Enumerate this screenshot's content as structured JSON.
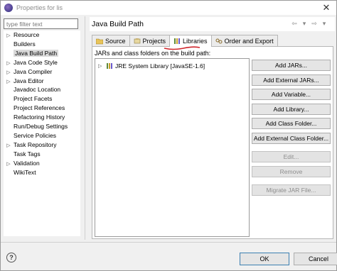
{
  "window": {
    "title": "Properties for lis",
    "close_glyph": "✕"
  },
  "filter": {
    "placeholder": "type filter text"
  },
  "tree": {
    "items": [
      {
        "label": "Resource",
        "expandable": true
      },
      {
        "label": "Builders",
        "expandable": false
      },
      {
        "label": "Java Build Path",
        "expandable": false,
        "selected": true
      },
      {
        "label": "Java Code Style",
        "expandable": true
      },
      {
        "label": "Java Compiler",
        "expandable": true
      },
      {
        "label": "Java Editor",
        "expandable": true
      },
      {
        "label": "Javadoc Location",
        "expandable": false
      },
      {
        "label": "Project Facets",
        "expandable": false
      },
      {
        "label": "Project References",
        "expandable": false
      },
      {
        "label": "Refactoring History",
        "expandable": false
      },
      {
        "label": "Run/Debug Settings",
        "expandable": false
      },
      {
        "label": "Service Policies",
        "expandable": false
      },
      {
        "label": "Task Repository",
        "expandable": true
      },
      {
        "label": "Task Tags",
        "expandable": false
      },
      {
        "label": "Validation",
        "expandable": true
      },
      {
        "label": "WikiText",
        "expandable": false
      }
    ]
  },
  "page": {
    "title": "Java Build Path",
    "nav_back": "⇦",
    "nav_forward": "⇨",
    "nav_menu": "▾"
  },
  "tabs": [
    {
      "label": "Source",
      "icon": "source-folder-icon"
    },
    {
      "label": "Projects",
      "icon": "projects-icon"
    },
    {
      "label": "Libraries",
      "icon": "libraries-icon",
      "active": true
    },
    {
      "label": "Order and Export",
      "icon": "order-export-icon"
    }
  ],
  "libraries": {
    "section_label": "JARs and class folders on the build path:",
    "entries": [
      {
        "label": "JRE System Library [JavaSE-1.6]"
      }
    ]
  },
  "buttons": [
    {
      "label": "Add JARs...",
      "enabled": true
    },
    {
      "label": "Add External JARs...",
      "enabled": true
    },
    {
      "label": "Add Variable...",
      "enabled": true
    },
    {
      "label": "Add Library...",
      "enabled": true
    },
    {
      "label": "Add Class Folder...",
      "enabled": true
    },
    {
      "label": "Add External Class Folder...",
      "enabled": true
    },
    {
      "label": "Edit...",
      "enabled": false
    },
    {
      "label": "Remove",
      "enabled": false
    },
    {
      "label": "Migrate JAR File...",
      "enabled": false
    }
  ],
  "footer": {
    "help": "?",
    "ok": "OK",
    "cancel": "Cancel"
  },
  "colors": {
    "annotation": "#d0262c",
    "selection": "#dadada"
  }
}
